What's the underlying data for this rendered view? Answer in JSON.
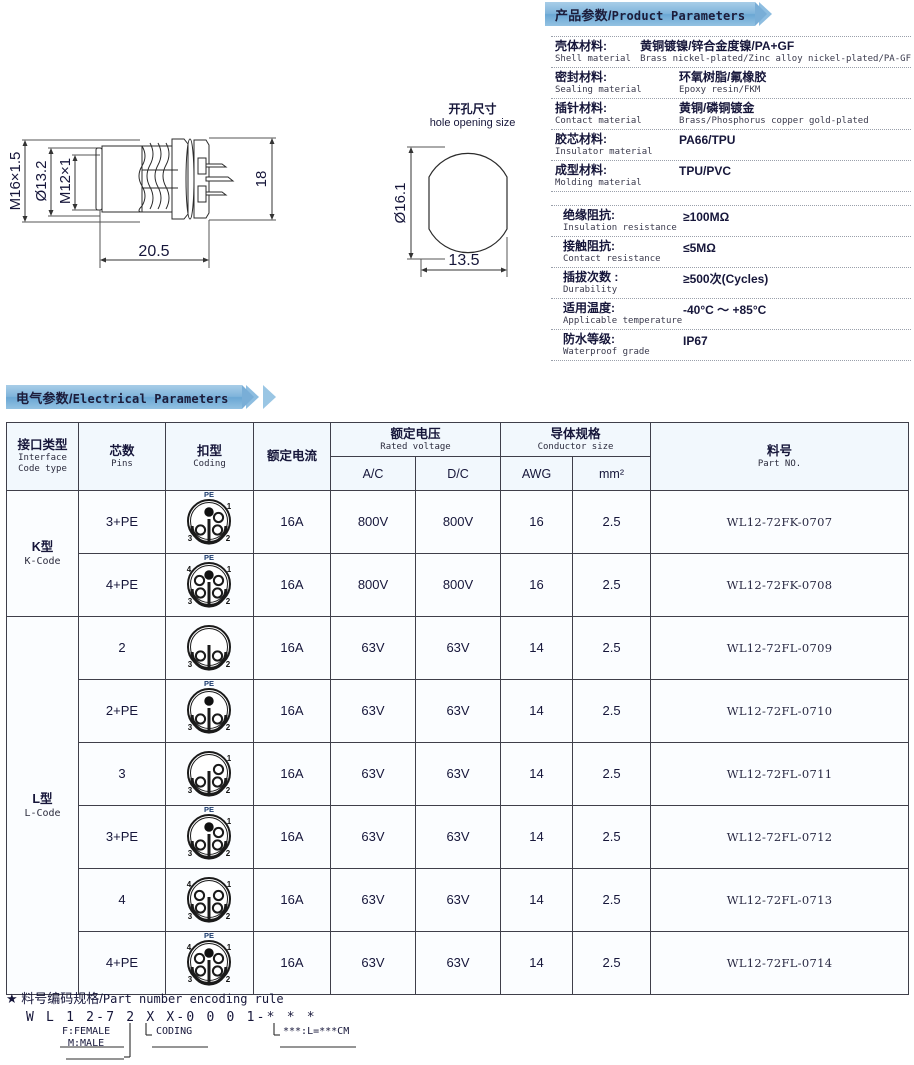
{
  "banners": {
    "product": {
      "cn": "产品参数",
      "sep": "/",
      "en": "Product Parameters"
    },
    "electrical": {
      "cn": "电气参数",
      "sep": "/",
      "en": "Electrical Parameters"
    }
  },
  "product_parameters": {
    "materials": [
      {
        "label_cn": "壳体材料:",
        "label_en": "Shell material",
        "value_cn": "黄铜镀镍/锌合金度镍/PA+GF",
        "value_en": "Brass nickel-plated/Zinc alloy nickel-plated/PA-GF"
      },
      {
        "label_cn": "密封材料:",
        "label_en": "Sealing material",
        "value_cn": "环氧树脂/氟橡胶",
        "value_en": "Epoxy resin/FKM"
      },
      {
        "label_cn": "插针材料:",
        "label_en": "Contact material",
        "value_cn": "黄铜/磷铜镀金",
        "value_en": "Brass/Phosphorus copper gold-plated"
      },
      {
        "label_cn": "胶芯材料:",
        "label_en": "Insulator material",
        "value_cn": "PA66/TPU",
        "value_en": ""
      },
      {
        "label_cn": "成型材料:",
        "label_en": "Molding material",
        "value_cn": "TPU/PVC",
        "value_en": ""
      }
    ],
    "specs": [
      {
        "label_cn": "绝缘阻抗:",
        "label_en": "Insulation resistance",
        "value": "≥100MΩ"
      },
      {
        "label_cn": "接触阻抗:",
        "label_en": "Contact resistance",
        "value": "≤5MΩ"
      },
      {
        "label_cn": "插拔次数 :",
        "label_en": "Durability",
        "value": "≥500次(Cycles)"
      },
      {
        "label_cn": "适用温度:",
        "label_en": "Applicable temperature",
        "value": "-40°C ～ +85°C"
      },
      {
        "label_cn": "防水等级:",
        "label_en": "Waterproof grade",
        "value": "IP67"
      }
    ]
  },
  "drawings": {
    "side_view": {
      "dimensions": {
        "thread_outer": "M16×1.5",
        "diameter": "Ø13.2",
        "thread_inner": "M12×1",
        "length": "20.5",
        "height": "18"
      }
    },
    "hole_view": {
      "title_cn": "开孔尺寸",
      "title_en": "hole opening size",
      "dimensions": {
        "diameter": "Ø16.1",
        "width": "13.5"
      }
    }
  },
  "electrical_table": {
    "headers": {
      "interface": {
        "cn": "接口类型",
        "en_line1": "Interface",
        "en_line2": "Code  type"
      },
      "pins": {
        "cn": "芯数",
        "en": "Pins"
      },
      "coding": {
        "cn": "扣型",
        "en": "Coding"
      },
      "current": {
        "cn": "额定电流",
        "en": ""
      },
      "voltage": {
        "cn": "额定电压",
        "en": "Rated voltage",
        "sub": [
          "A/C",
          "D/C"
        ]
      },
      "conductor": {
        "cn": "导体规格",
        "en": "Conductor size",
        "sub": [
          "AWG",
          "mm²"
        ]
      },
      "partno": {
        "cn": "料号",
        "en": "Part NO."
      }
    },
    "groups": [
      {
        "type_cn": "K型",
        "type_en": "K-Code",
        "rowspan": 2,
        "rows": [
          {
            "pins": "3+PE",
            "coding": "k3pe",
            "current": "16A",
            "ac": "800V",
            "dc": "800V",
            "awg": "16",
            "mm2": "2.5",
            "partno": "WL12-72FK-0707"
          },
          {
            "pins": "4+PE",
            "coding": "k4pe",
            "current": "16A",
            "ac": "800V",
            "dc": "800V",
            "awg": "16",
            "mm2": "2.5",
            "partno": "WL12-72FK-0708"
          }
        ]
      },
      {
        "type_cn": "L型",
        "type_en": "L-Code",
        "rowspan": 6,
        "rows": [
          {
            "pins": "2",
            "coding": "l2",
            "current": "16A",
            "ac": "63V",
            "dc": "63V",
            "awg": "14",
            "mm2": "2.5",
            "partno": "WL12-72FL-0709"
          },
          {
            "pins": "2+PE",
            "coding": "l2pe",
            "current": "16A",
            "ac": "63V",
            "dc": "63V",
            "awg": "14",
            "mm2": "2.5",
            "partno": "WL12-72FL-0710"
          },
          {
            "pins": "3",
            "coding": "l3",
            "current": "16A",
            "ac": "63V",
            "dc": "63V",
            "awg": "14",
            "mm2": "2.5",
            "partno": "WL12-72FL-0711"
          },
          {
            "pins": "3+PE",
            "coding": "l3pe",
            "current": "16A",
            "ac": "63V",
            "dc": "63V",
            "awg": "14",
            "mm2": "2.5",
            "partno": "WL12-72FL-0712"
          },
          {
            "pins": "4",
            "coding": "l4",
            "current": "16A",
            "ac": "63V",
            "dc": "63V",
            "awg": "14",
            "mm2": "2.5",
            "partno": "WL12-72FL-0713"
          },
          {
            "pins": "4+PE",
            "coding": "l4pe",
            "current": "16A",
            "ac": "63V",
            "dc": "63V",
            "awg": "14",
            "mm2": "2.5",
            "partno": "WL12-72FL-0714"
          }
        ]
      }
    ]
  },
  "encoding_rule": {
    "star": "★",
    "title_cn": "料号编码规格",
    "title_sep": "/",
    "title_en": "Part number encoding rule",
    "code": "W L 1 2-7 2 X X-0 0 0 1-* * *",
    "notes": {
      "female": "F:FEMALE",
      "male": "M:MALE",
      "coding": "CODING",
      "length": "***:L=***CM"
    }
  },
  "colors": {
    "banner_blue": "#7fb4db",
    "table_border": "#3f3f4a",
    "text_dark": "#16163a",
    "cell_bg": "#fbfdff"
  }
}
